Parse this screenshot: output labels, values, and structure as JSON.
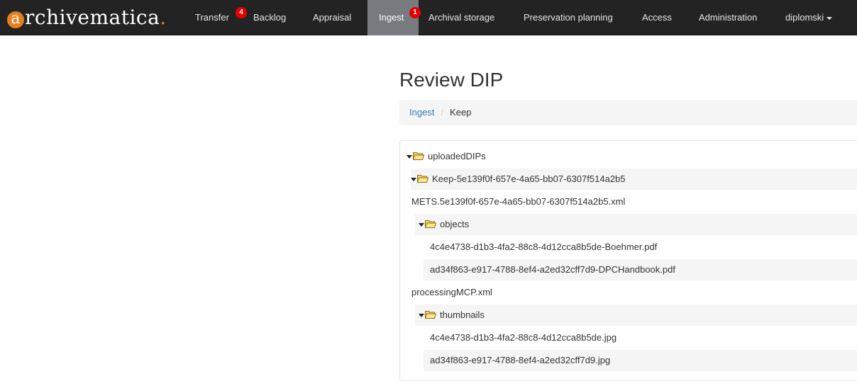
{
  "app": {
    "brand_letter": "a",
    "brand_rest": "rchivematica",
    "brand_dot": "."
  },
  "nav": {
    "transfer": "Transfer",
    "transfer_badge": "4",
    "backlog": "Backlog",
    "appraisal": "Appraisal",
    "ingest": "Ingest",
    "ingest_badge": "1",
    "archival_storage": "Archival storage",
    "preservation_planning": "Preservation planning",
    "access": "Access",
    "administration": "Administration",
    "user": "diplomski"
  },
  "page": {
    "title": "Review DIP"
  },
  "breadcrumb": {
    "ingest": "Ingest",
    "separator": "/",
    "current": "Keep"
  },
  "tree": {
    "root": "uploadedDIPs",
    "package": "Keep-5e139f0f-657e-4a65-bb07-6307f514a2b5",
    "mets": "METS.5e139f0f-657e-4a65-bb07-6307f514a2b5.xml",
    "objects": "objects",
    "object_files": [
      "4c4e4738-d1b3-4fa2-88c8-4d12cca8b5de-Boehmer.pdf",
      "ad34f863-e917-4788-8ef4-a2ed32cff7d9-DPCHandbook.pdf"
    ],
    "processing": "processingMCP.xml",
    "thumbnails": "thumbnails",
    "thumbnail_files": [
      "4c4e4738-d1b3-4fa2-88c8-4d12cca8b5de.jpg",
      "ad34f863-e917-4788-8ef4-a2ed32cff7d9.jpg"
    ]
  },
  "colors": {
    "navbar": "#232323",
    "active_nav": "#777b80",
    "badge": "#e60000",
    "brand_accent": "#e8801e",
    "link": "#337ab7"
  }
}
